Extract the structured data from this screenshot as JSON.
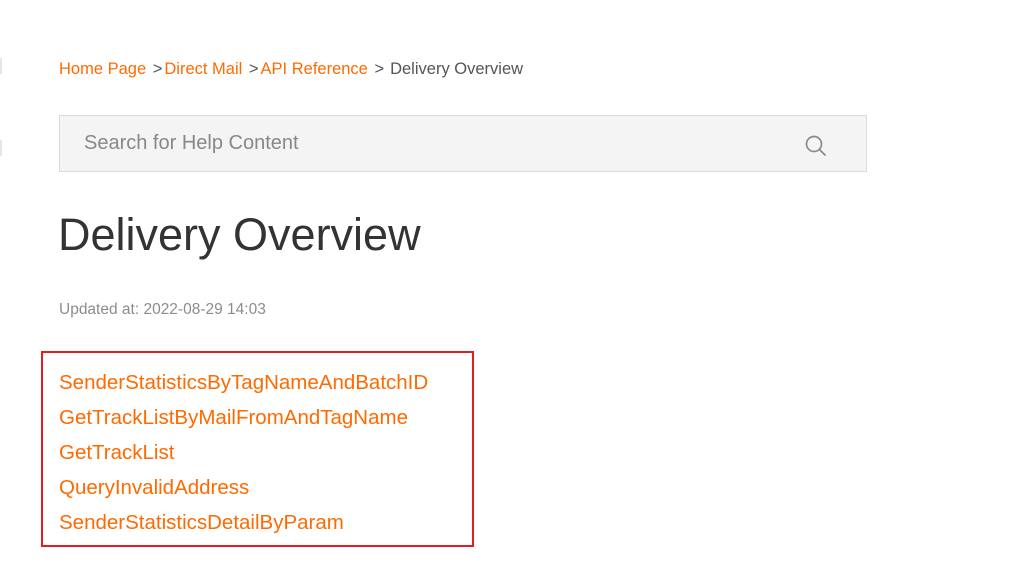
{
  "breadcrumb": {
    "items": [
      "Home Page",
      "Direct Mail",
      "API Reference"
    ],
    "separator": ">",
    "current": "Delivery Overview"
  },
  "search": {
    "placeholder": "Search for Help Content",
    "value": ""
  },
  "page": {
    "title": "Delivery Overview",
    "updated": "Updated at: 2022-08-29 14:03"
  },
  "links": [
    "SenderStatisticsByTagNameAndBatchID",
    "GetTrackListByMailFromAndTagName",
    "GetTrackList",
    "QueryInvalidAddress",
    "SenderStatisticsDetailByParam"
  ],
  "icons": {
    "search": "search-icon"
  },
  "colors": {
    "accent": "#ff6a00",
    "highlight_border": "#e02020",
    "title": "#333333",
    "muted": "#8c8c8c",
    "search_bg": "#f4f4f5"
  }
}
